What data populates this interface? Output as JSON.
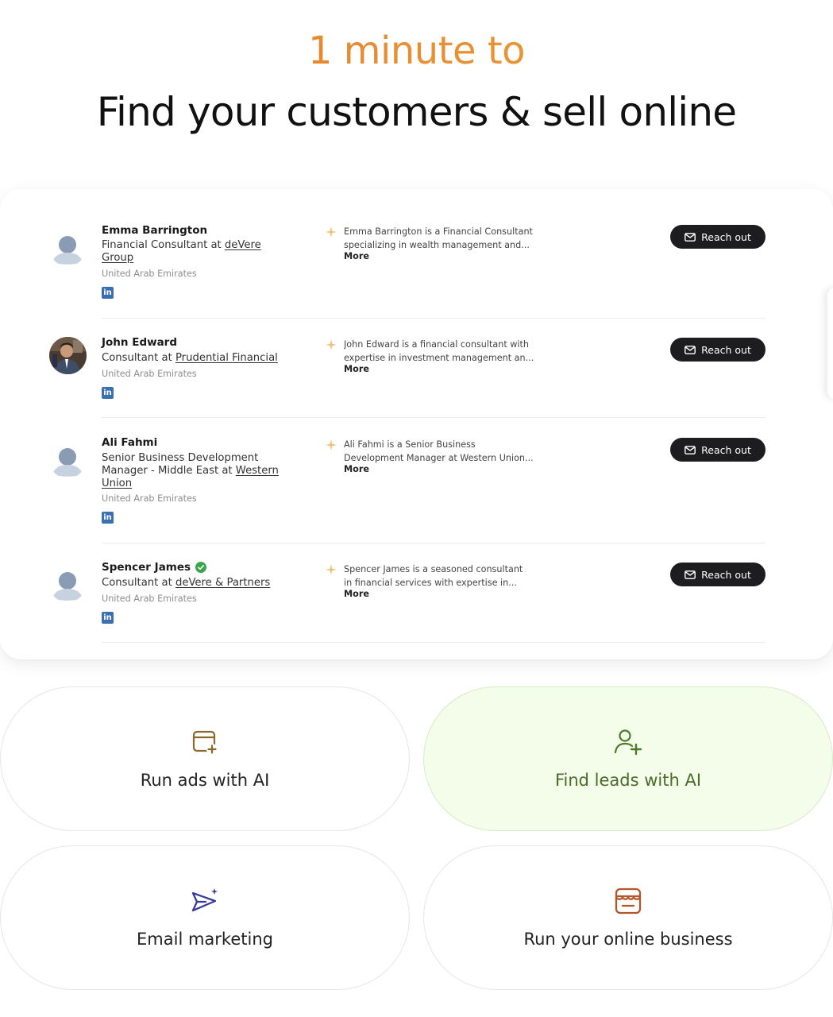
{
  "hero": {
    "eyebrow": "1 minute to",
    "title": "Find your customers & sell online"
  },
  "leads": [
    {
      "name": "Emma Barrington",
      "verified": false,
      "role_prefix": "Financial Consultant at ",
      "company": "deVere Group",
      "location": "United Arab Emirates",
      "summary_line1": "Emma Barrington is a Financial Consultant",
      "summary_line2": "specializing in wealth management and...",
      "more": "More",
      "cta": "Reach out",
      "avatar": "placeholder"
    },
    {
      "name": "John Edward",
      "verified": false,
      "role_prefix": "Consultant at ",
      "company": "Prudential Financial",
      "location": "United Arab Emirates",
      "summary_line1": "John Edward is a financial consultant with",
      "summary_line2": "expertise in investment management an...",
      "more": "More",
      "cta": "Reach out",
      "avatar": "photo"
    },
    {
      "name": "Ali Fahmi",
      "verified": false,
      "role_prefix": "Senior Business Development Manager - Middle East at ",
      "company": "Western Union",
      "location": "United Arab Emirates",
      "summary_line1": "Ali Fahmi is a Senior Business",
      "summary_line2": "Development Manager at Western Union...",
      "more": "More",
      "cta": "Reach out",
      "avatar": "placeholder"
    },
    {
      "name": "Spencer James",
      "verified": true,
      "role_prefix": "Consultant at ",
      "company": "deVere & Partners",
      "location": "United Arab Emirates",
      "summary_line1": "Spencer James is a seasoned consultant",
      "summary_line2": "in financial services with expertise in...",
      "more": "More",
      "cta": "Reach out",
      "avatar": "placeholder"
    }
  ],
  "features": [
    {
      "label": "Run ads with AI",
      "icon": "ad-calendar-plus-icon",
      "active": false,
      "icon_color": "#8a6a2c"
    },
    {
      "label": "Find leads with AI",
      "icon": "user-plus-icon",
      "active": true,
      "icon_color": "#4b7a2a"
    },
    {
      "label": "Email marketing",
      "icon": "send-sparkle-icon",
      "active": false,
      "icon_color": "#3a3a9a"
    },
    {
      "label": "Run your online business",
      "icon": "storefront-icon",
      "active": false,
      "icon_color": "#b5552a"
    }
  ],
  "colors": {
    "eyebrow_gradient_start": "#e27a2a",
    "eyebrow_gradient_end": "#eda33a",
    "cta_background": "#1d1d1f",
    "linkedin": "#3a6fb0",
    "verified": "#3aa64c",
    "active_pill_background": "#f4fde9"
  }
}
